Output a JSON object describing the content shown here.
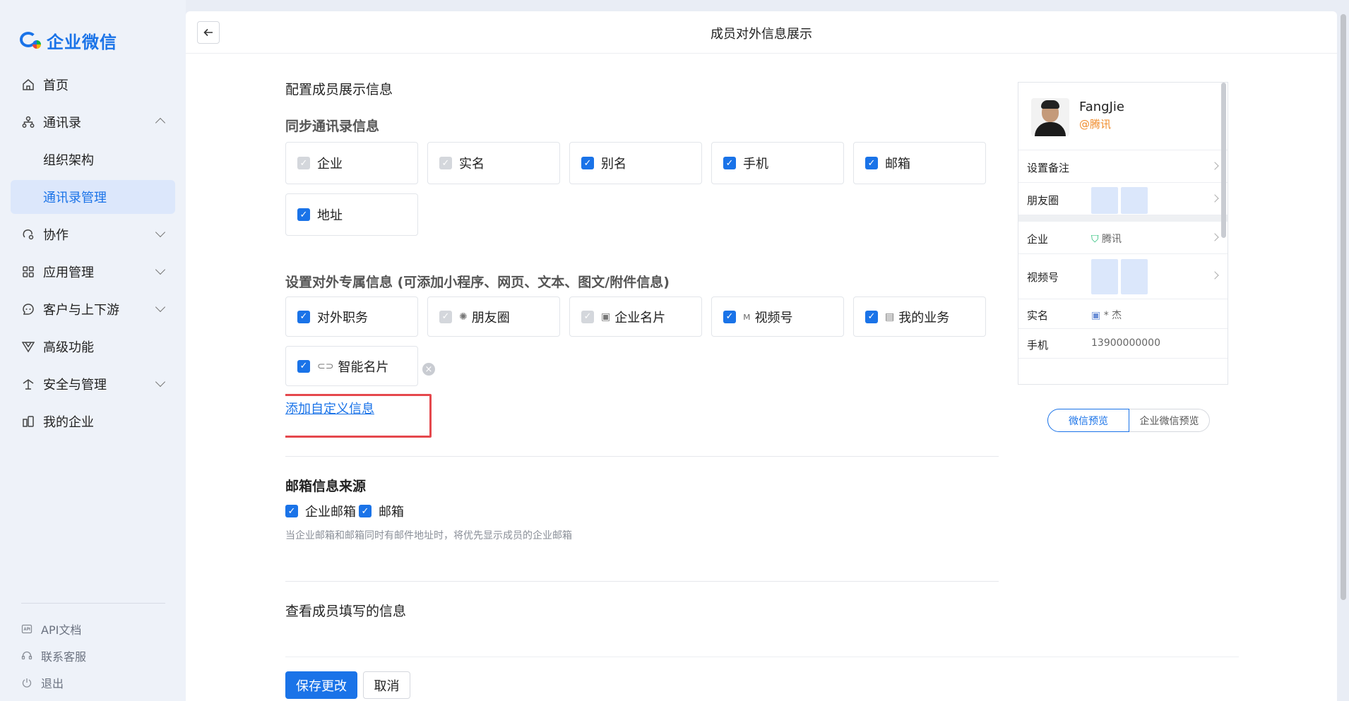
{
  "app": {
    "name": "企业微信",
    "page_title": "成员对外信息展示"
  },
  "sidebar": {
    "items": [
      {
        "label": "首页",
        "icon": "home-icon"
      },
      {
        "label": "通讯录",
        "icon": "org-icon"
      },
      {
        "label": "组织架构"
      },
      {
        "label": "通讯录管理"
      },
      {
        "label": "协作",
        "icon": "collab-icon"
      },
      {
        "label": "应用管理",
        "icon": "apps-icon"
      },
      {
        "label": "客户与上下游",
        "icon": "customer-icon"
      },
      {
        "label": "高级功能",
        "icon": "advanced-icon"
      },
      {
        "label": "安全与管理",
        "icon": "security-icon"
      },
      {
        "label": "我的企业",
        "icon": "company-icon"
      }
    ],
    "bottom": [
      {
        "label": "API文档",
        "icon": "api-icon"
      },
      {
        "label": "联系客服",
        "icon": "headset-icon"
      },
      {
        "label": "退出",
        "icon": "power-icon"
      }
    ]
  },
  "config": {
    "heading": "配置成员展示信息",
    "sync_heading": "同步通讯录信息",
    "sync_items": [
      {
        "label": "企业",
        "checked": true,
        "disabled": true
      },
      {
        "label": "实名",
        "checked": true,
        "disabled": true
      },
      {
        "label": "别名",
        "checked": true,
        "disabled": false
      },
      {
        "label": "手机",
        "checked": true,
        "disabled": false
      },
      {
        "label": "邮箱",
        "checked": true,
        "disabled": false
      },
      {
        "label": "地址",
        "checked": true,
        "disabled": false
      }
    ],
    "exclusive_heading": "设置对外专属信息 (可添加小程序、网页、文本、图文/附件信息)",
    "exclusive_items": [
      {
        "label": "对外职务",
        "icon": "",
        "disabled": false
      },
      {
        "label": "朋友圈",
        "icon": "moments-icon",
        "disabled": true
      },
      {
        "label": "企业名片",
        "icon": "card-icon",
        "disabled": true
      },
      {
        "label": "视频号",
        "icon": "channels-icon",
        "disabled": false
      },
      {
        "label": "我的业务",
        "icon": "doc-icon",
        "disabled": false
      },
      {
        "label": "智能名片",
        "icon": "link-icon",
        "disabled": false
      }
    ],
    "add_custom_link": "添加自定义信息"
  },
  "mail": {
    "heading": "邮箱信息来源",
    "opt1": "企业邮箱",
    "opt2": "邮箱",
    "hint": "当企业邮箱和邮箱同时有邮件地址时，将优先显示成员的企业邮箱"
  },
  "view_section": {
    "heading": "查看成员填写的信息"
  },
  "actions": {
    "save": "保存更改",
    "cancel": "取消"
  },
  "preview": {
    "name": "FangJie",
    "corp": "@腾讯",
    "rows": {
      "remark": "设置备注",
      "moments": "朋友圈",
      "company_label": "企业",
      "company_value": "腾讯",
      "channels": "视频号",
      "realname_label": "实名",
      "realname_value": "* 杰",
      "phone_label": "手机",
      "phone_value": "13900000000"
    },
    "tabs": {
      "wechat": "微信预览",
      "wecom": "企业微信预览"
    }
  },
  "colors": {
    "accent": "#1a73e8",
    "highlight_frame": "#e5484d",
    "corp_orange": "#f08c2c"
  }
}
